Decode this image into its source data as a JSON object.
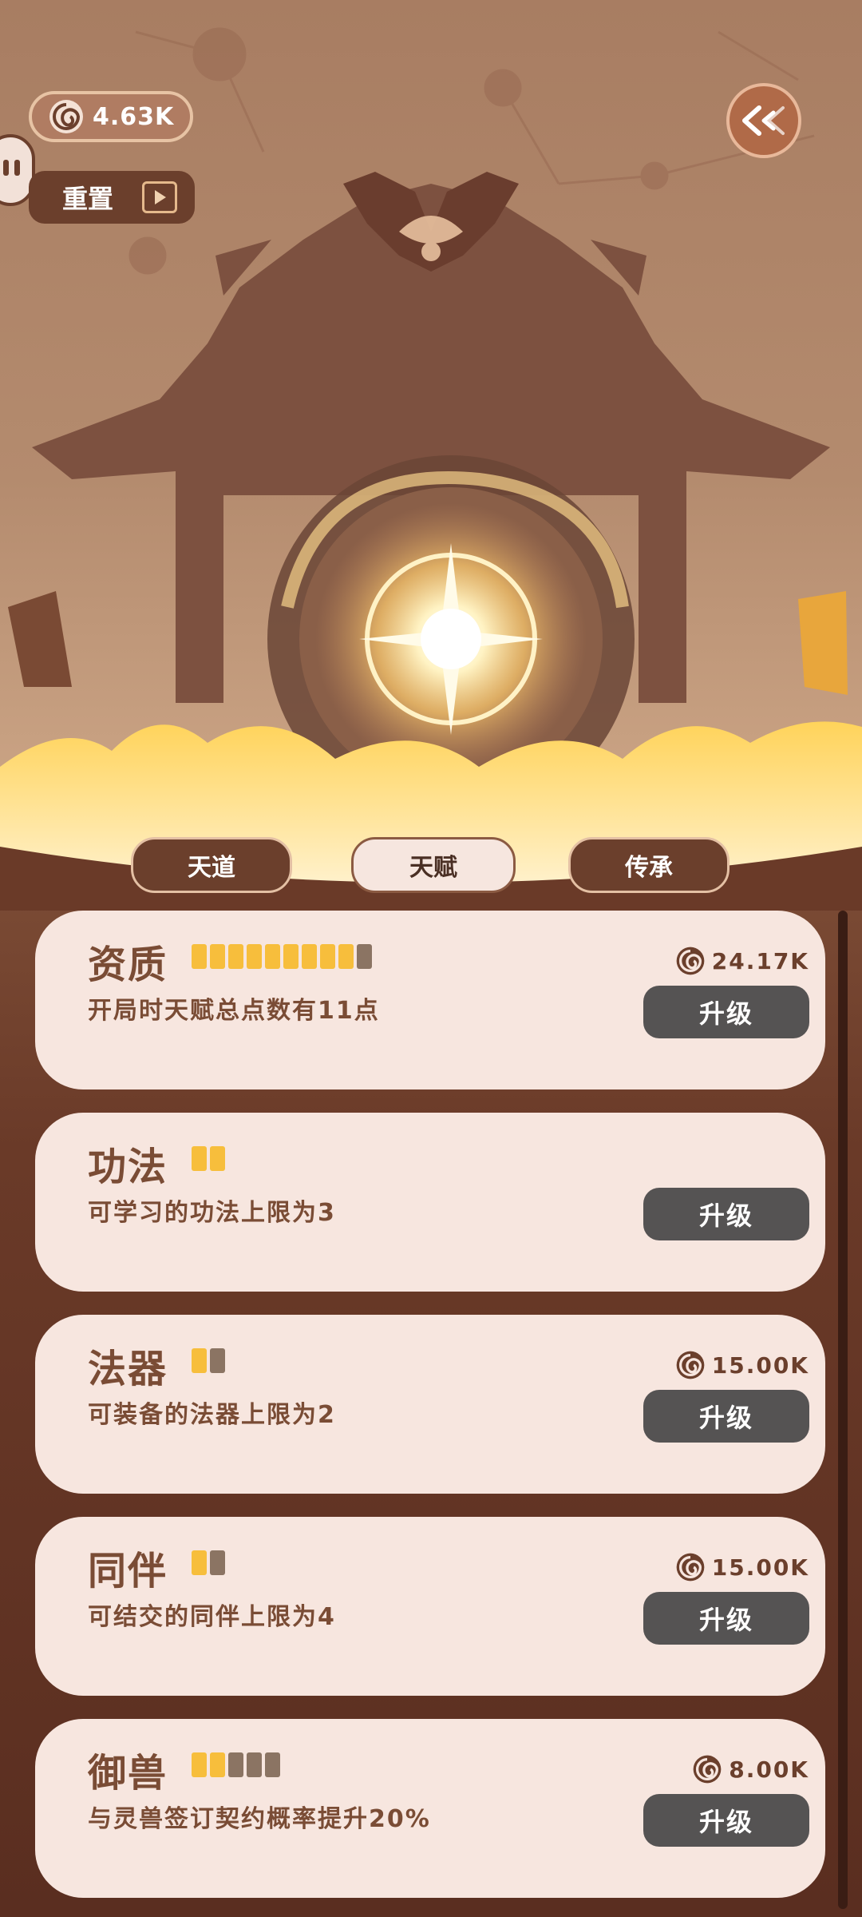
{
  "currency": {
    "amount": "4.63K",
    "icon": "spiral-coin-icon"
  },
  "reset": {
    "label": "重置",
    "icon": "video-ad-icon"
  },
  "back": {
    "icon": "chevron-back-icon"
  },
  "tabs": [
    {
      "label": "天道",
      "active": false
    },
    {
      "label": "天赋",
      "active": true
    },
    {
      "label": "传承",
      "active": false
    }
  ],
  "cards": [
    {
      "title": "资质",
      "pips_total": 10,
      "pips_on": 9,
      "desc": "开局时天赋总点数有11点",
      "cost": "24.17K",
      "button": "升级"
    },
    {
      "title": "功法",
      "pips_total": 2,
      "pips_on": 2,
      "desc": "可学习的功法上限为3",
      "cost": "",
      "button": "升级"
    },
    {
      "title": "法器",
      "pips_total": 2,
      "pips_on": 1,
      "desc": "可装备的法器上限为2",
      "cost": "15.00K",
      "button": "升级"
    },
    {
      "title": "同伴",
      "pips_total": 2,
      "pips_on": 1,
      "desc": "可结交的同伴上限为4",
      "cost": "15.00K",
      "button": "升级"
    },
    {
      "title": "御兽",
      "pips_total": 5,
      "pips_on": 2,
      "desc": "与灵兽签订契约概率提升20%",
      "cost": "8.00K",
      "button": "升级"
    }
  ],
  "colors": {
    "pip_on": "#f7be3c",
    "pip_off": "#8b7463",
    "button": "#555353",
    "card": "#f7e6df",
    "text": "#7a4c35"
  }
}
